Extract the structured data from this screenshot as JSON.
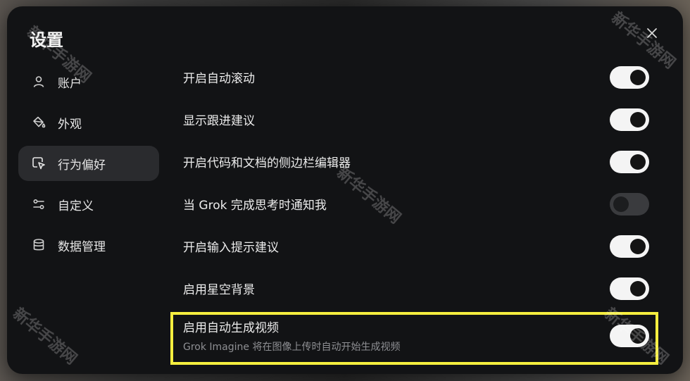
{
  "dialog": {
    "title": "设置"
  },
  "sidebar": {
    "items": [
      {
        "label": "账户",
        "icon": "user-icon"
      },
      {
        "label": "外观",
        "icon": "paint-bucket-icon"
      },
      {
        "label": "行为偏好",
        "icon": "cursor-pointer-icon",
        "active": true
      },
      {
        "label": "自定义",
        "icon": "sliders-icon"
      },
      {
        "label": "数据管理",
        "icon": "database-icon"
      }
    ]
  },
  "settings": [
    {
      "label": "开启自动滚动",
      "enabled": true
    },
    {
      "label": "显示跟进建议",
      "enabled": true
    },
    {
      "label": "开启代码和文档的侧边栏编辑器",
      "enabled": true
    },
    {
      "label": "当 Grok 完成思考时通知我",
      "enabled": false
    },
    {
      "label": "开启输入提示建议",
      "enabled": true
    },
    {
      "label": "启用星空背景",
      "enabled": true
    },
    {
      "label": "启用自动生成视频",
      "description": "Grok Imagine 将在图像上传时自动开始生成视频",
      "enabled": true
    }
  ],
  "watermark": {
    "text": "新华手游网"
  },
  "colors": {
    "highlight": "#f5ee3f",
    "modal_bg": "#121315",
    "toggle_on": "#f4f4f4"
  }
}
